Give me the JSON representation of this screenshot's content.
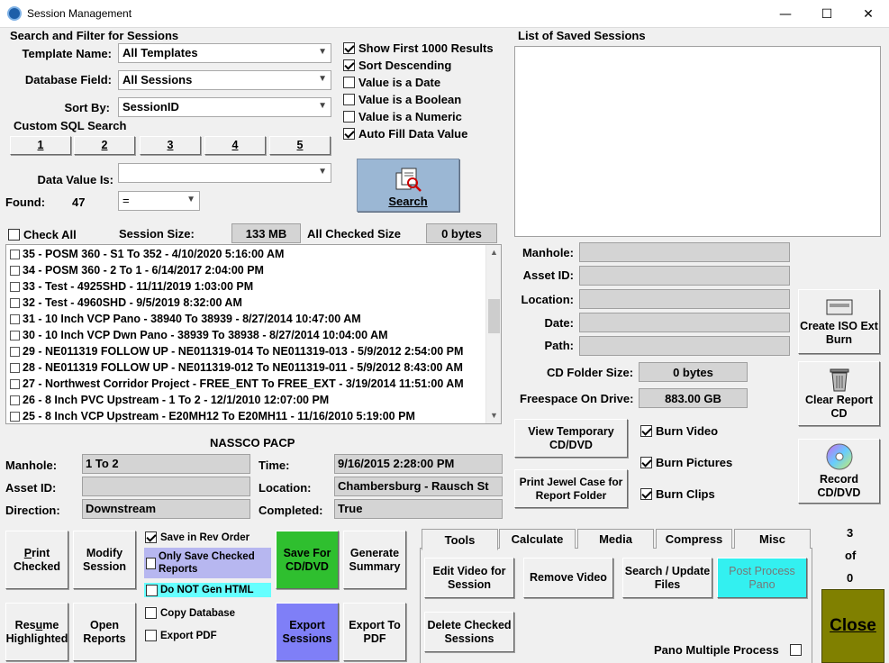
{
  "window": {
    "title": "Session Management",
    "min": "—",
    "max": "☐",
    "close": "✕"
  },
  "search": {
    "heading": "Search and Filter for Sessions",
    "template_label": "Template Name:",
    "template_value": "All Templates",
    "dbfield_label": "Database Field:",
    "dbfield_value": "All Sessions",
    "sortby_label": "Sort By:",
    "sortby_value": "SessionID",
    "custom_sql": "Custom SQL Search",
    "sql_buttons": [
      "1",
      "2",
      "3",
      "4",
      "5"
    ],
    "datavalue_label": "Data Value Is:",
    "datavalue_value": "",
    "found_label": "Found:",
    "found_value": "47",
    "operator_value": "=",
    "search_button": "Search"
  },
  "options": [
    {
      "label": "Show First 1000 Results",
      "checked": true
    },
    {
      "label": "Sort Descending",
      "checked": true
    },
    {
      "label": "Value is a Date",
      "checked": false
    },
    {
      "label": "Value is a Boolean",
      "checked": false
    },
    {
      "label": "Value is a Numeric",
      "checked": false
    },
    {
      "label": "Auto Fill Data Value",
      "checked": true
    }
  ],
  "sizes": {
    "check_all": "Check All",
    "session_size_label": "Session Size:",
    "session_size_value": "133 MB",
    "all_checked_label": "All Checked Size",
    "all_checked_value": "0 bytes"
  },
  "sessions": [
    "35 - POSM 360 - S1 To 352 - 4/10/2020 5:16:00 AM",
    "34 - POSM 360 - 2 To 1 - 6/14/2017 2:04:00 PM",
    "33 - Test - 4925SHD - 11/11/2019 1:03:00 PM",
    "32 - Test - 4960SHD - 9/5/2019 8:32:00 AM",
    "31 - 10 Inch VCP Pano - 38940 To 38939 - 8/27/2014 10:47:00 AM",
    "30 - 10 Inch VCP Dwn Pano - 38939 To 38938 - 8/27/2014 10:04:00 AM",
    "29 - NE011319 FOLLOW UP - NE011319-014 To NE011319-013 - 5/9/2012 2:54:00 PM",
    "28 - NE011319 FOLLOW UP - NE011319-012 To NE011319-011 - 5/9/2012 8:43:00 AM",
    "27 - Northwest Corridor Project - FREE_ENT To FREE_EXT - 3/19/2014 11:51:00 AM",
    "26 - 8 Inch PVC Upstream - 1 To 2 - 12/1/2010 12:07:00 PM",
    "25 - 8 Inch VCP Upstream - E20MH12 To E20MH11 - 11/16/2010 5:19:00 PM"
  ],
  "pacp": {
    "heading": "NASSCO PACP",
    "manhole_label": "Manhole:",
    "manhole_value": "1 To 2",
    "assetid_label": "Asset ID:",
    "assetid_value": "",
    "direction_label": "Direction:",
    "direction_value": "Downstream",
    "time_label": "Time:",
    "time_value": "9/16/2015 2:28:00 PM",
    "location_label": "Location:",
    "location_value": "Chambersburg - Rausch St",
    "completed_label": "Completed:",
    "completed_value": "True"
  },
  "saved": {
    "heading": "List of Saved Sessions",
    "manhole_label": "Manhole:",
    "assetid_label": "Asset ID:",
    "location_label": "Location:",
    "date_label": "Date:",
    "path_label": "Path:",
    "cdfolder_label": "CD Folder Size:",
    "cdfolder_value": "0 bytes",
    "freespace_label": "Freespace On Drive:",
    "freespace_value": "883.00 GB",
    "view_temp": "View Temporary CD/DVD",
    "print_jewel": "Print Jewel Case for Report Folder",
    "burn_video": "Burn Video",
    "burn_pictures": "Burn Pictures",
    "burn_clips": "Burn Clips",
    "create_iso": "Create ISO Ext Burn",
    "clear_report": "Clear Report CD",
    "record": "Record CD/DVD"
  },
  "bottom": {
    "print_checked": "Print Checked",
    "modify_session": "Modify Session",
    "save_rev": "Save in Rev Order",
    "only_save_checked": "Only Save Checked Reports",
    "do_not_gen": "Do NOT Gen HTML",
    "save_for_cd": "Save For CD/DVD",
    "generate_summary": "Generate Summary",
    "resume_highlighted": "Resume Highlighted",
    "open_reports": "Open Reports",
    "copy_database": "Copy Database",
    "export_pdf": "Export PDF",
    "export_sessions": "Export Sessions",
    "export_to_pdf": "Export To PDF"
  },
  "tabs": [
    "Tools",
    "Calculate",
    "Media",
    "Compress",
    "Misc"
  ],
  "tools": {
    "edit_video": "Edit Video for Session",
    "remove_video": "Remove Video",
    "search_update": "Search / Update Files",
    "post_process": "Post Process Pano",
    "delete_checked": "Delete Checked Sessions",
    "pano_multiple": "Pano Multiple Process"
  },
  "counter": {
    "current": "3",
    "of": "of",
    "total": "0"
  },
  "close_button": "Close",
  "colors": {
    "save_for_cd": "#2fbf2f",
    "export_sessions": "#7f7ff7",
    "post_process": "#33f0f0",
    "close": "#808000",
    "search_btn": "#9bb7d4",
    "only_save": "#b7b7f0",
    "do_not_gen": "#66ffff"
  }
}
